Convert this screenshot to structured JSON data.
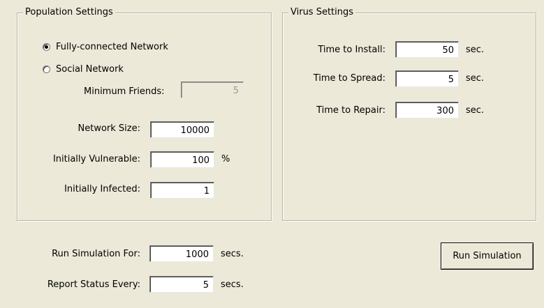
{
  "population": {
    "title": "Population Settings",
    "radio_fully_connected": "Fully-connected Network",
    "radio_social": "Social Network",
    "selected": "fully_connected",
    "min_friends_label": "Minimum Friends:",
    "min_friends_value": "5",
    "network_size_label": "Network Size:",
    "network_size_value": "10000",
    "vulnerable_label": "Initially Vulnerable:",
    "vulnerable_value": "100",
    "vulnerable_unit": "%",
    "infected_label": "Initially Infected:",
    "infected_value": "1"
  },
  "virus": {
    "title": "Virus Settings",
    "install_label": "Time to Install:",
    "install_value": "50",
    "spread_label": "Time to Spread:",
    "spread_value": "5",
    "repair_label": "Time to Repair:",
    "repair_value": "300",
    "unit": "sec."
  },
  "run": {
    "run_for_label": "Run Simulation For:",
    "run_for_value": "1000",
    "report_label": "Report Status Every:",
    "report_value": "5",
    "unit": "secs.",
    "button_label": "Run Simulation"
  }
}
